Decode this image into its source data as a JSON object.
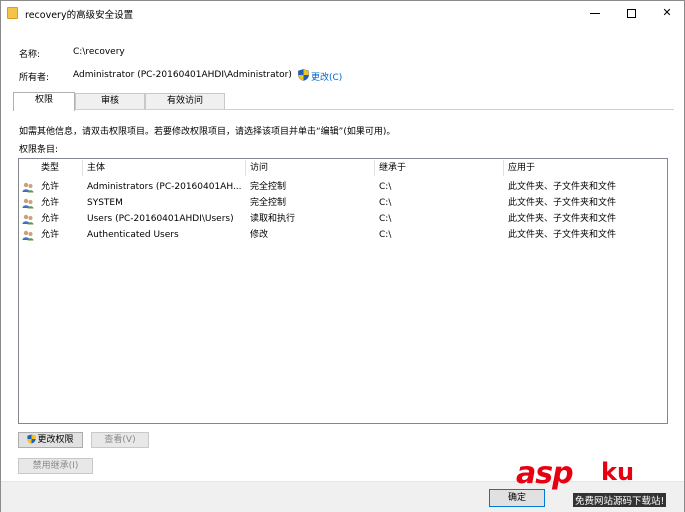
{
  "window": {
    "title": "recovery的高级安全设置"
  },
  "info": {
    "name_label": "名称:",
    "name_value": "C:\\recovery",
    "owner_label": "所有者:",
    "owner_value": "Administrator (PC-20160401AHDI\\Administrator)",
    "change_link": "更改(C)"
  },
  "tabs": [
    {
      "label": "权限",
      "active": true
    },
    {
      "label": "审核",
      "active": false
    },
    {
      "label": "有效访问",
      "active": false
    }
  ],
  "hint_text": "如需其他信息，请双击权限项目。若要修改权限项目，请选择该项目并单击“编辑”(如果可用)。",
  "entries_label": "权限条目:",
  "table": {
    "headers": [
      "类型",
      "主体",
      "访问",
      "继承于",
      "应用于"
    ],
    "rows": [
      [
        "允许",
        "Administrators (PC-20160401AH...",
        "完全控制",
        "C:\\",
        "此文件夹、子文件夹和文件"
      ],
      [
        "允许",
        "SYSTEM",
        "完全控制",
        "C:\\",
        "此文件夹、子文件夹和文件"
      ],
      [
        "允许",
        "Users (PC-20160401AHDI\\Users)",
        "读取和执行",
        "C:\\",
        "此文件夹、子文件夹和文件"
      ],
      [
        "允许",
        "Authenticated Users",
        "修改",
        "C:\\",
        "此文件夹、子文件夹和文件"
      ]
    ]
  },
  "buttons": {
    "change_permissions": "更改权限",
    "view": "查看(V)",
    "disable_inheritance": "禁用继承(I)",
    "ok": "确定"
  },
  "watermark": {
    "brand": "asp",
    "brand_cn": "ku",
    "slogan": "免费网站源码下载站!"
  }
}
